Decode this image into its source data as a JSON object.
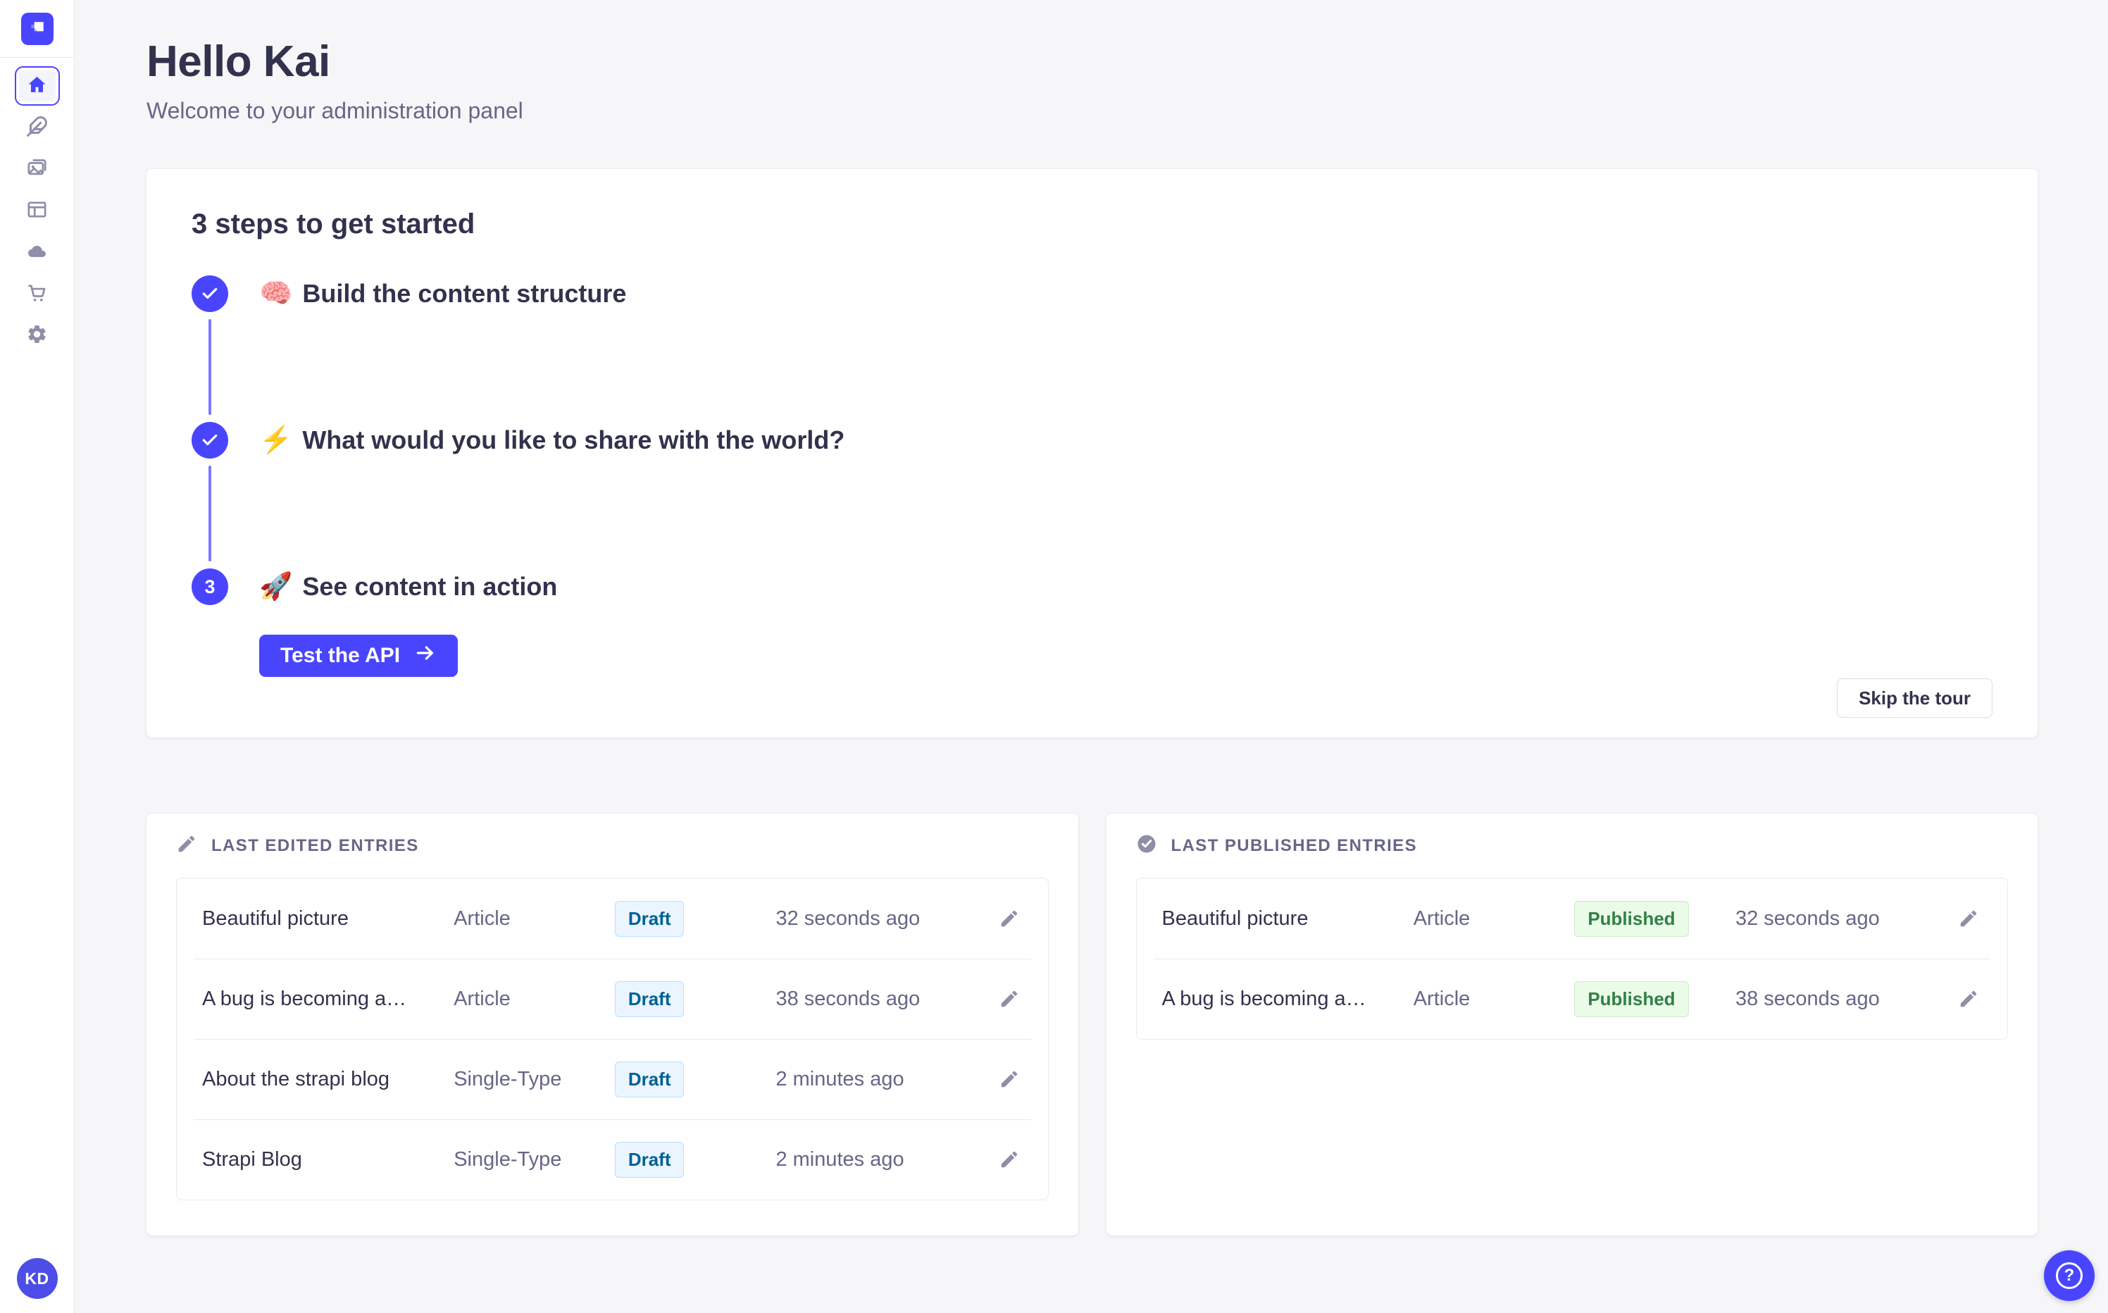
{
  "colors": {
    "primary": "#4945FF",
    "connector": "#7B79FF",
    "draft": {
      "bg": "#EAF5FF",
      "border": "#B8E1FF",
      "text": "#006096"
    },
    "published": {
      "bg": "#EAFBE7",
      "border": "#C6F0C2",
      "text": "#328048"
    }
  },
  "sidebar": {
    "logo_icon": "strapi-logo-icon",
    "items": [
      {
        "icon": "home-icon",
        "active": true
      },
      {
        "icon": "feather-icon",
        "active": false
      },
      {
        "icon": "media-library-icon",
        "active": false
      },
      {
        "icon": "layout-icon",
        "active": false
      },
      {
        "icon": "cloud-icon",
        "active": false
      },
      {
        "icon": "cart-icon",
        "active": false
      },
      {
        "icon": "gear-icon",
        "active": false
      }
    ],
    "avatar_initials": "KD"
  },
  "header": {
    "title": "Hello Kai",
    "subtitle": "Welcome to your administration panel"
  },
  "onboarding": {
    "title": "3 steps to get started",
    "steps": [
      {
        "emoji": "🧠",
        "label": "Build the content structure",
        "state": "done"
      },
      {
        "emoji": "⚡",
        "label": "What would you like to share with the world?",
        "state": "done"
      },
      {
        "emoji": "🚀",
        "label": "See content in action",
        "state": "current",
        "number": "3"
      }
    ],
    "cta_label": "Test the API",
    "skip_label": "Skip the tour"
  },
  "panels": {
    "edited": {
      "title": "LAST EDITED ENTRIES",
      "icon": "pencil-icon",
      "rows": [
        {
          "name": "Beautiful picture",
          "type": "Article",
          "status": "Draft",
          "time": "32 seconds ago"
        },
        {
          "name": "A bug is becoming a…",
          "type": "Article",
          "status": "Draft",
          "time": "38 seconds ago"
        },
        {
          "name": "About the strapi blog",
          "type": "Single-Type",
          "status": "Draft",
          "time": "2 minutes ago"
        },
        {
          "name": "Strapi Blog",
          "type": "Single-Type",
          "status": "Draft",
          "time": "2 minutes ago"
        }
      ]
    },
    "published": {
      "title": "LAST PUBLISHED ENTRIES",
      "icon": "check-circle-icon",
      "rows": [
        {
          "name": "Beautiful picture",
          "type": "Article",
          "status": "Published",
          "time": "32 seconds ago"
        },
        {
          "name": "A bug is becoming a…",
          "type": "Article",
          "status": "Published",
          "time": "38 seconds ago"
        }
      ]
    }
  },
  "help": {
    "glyph": "?"
  }
}
